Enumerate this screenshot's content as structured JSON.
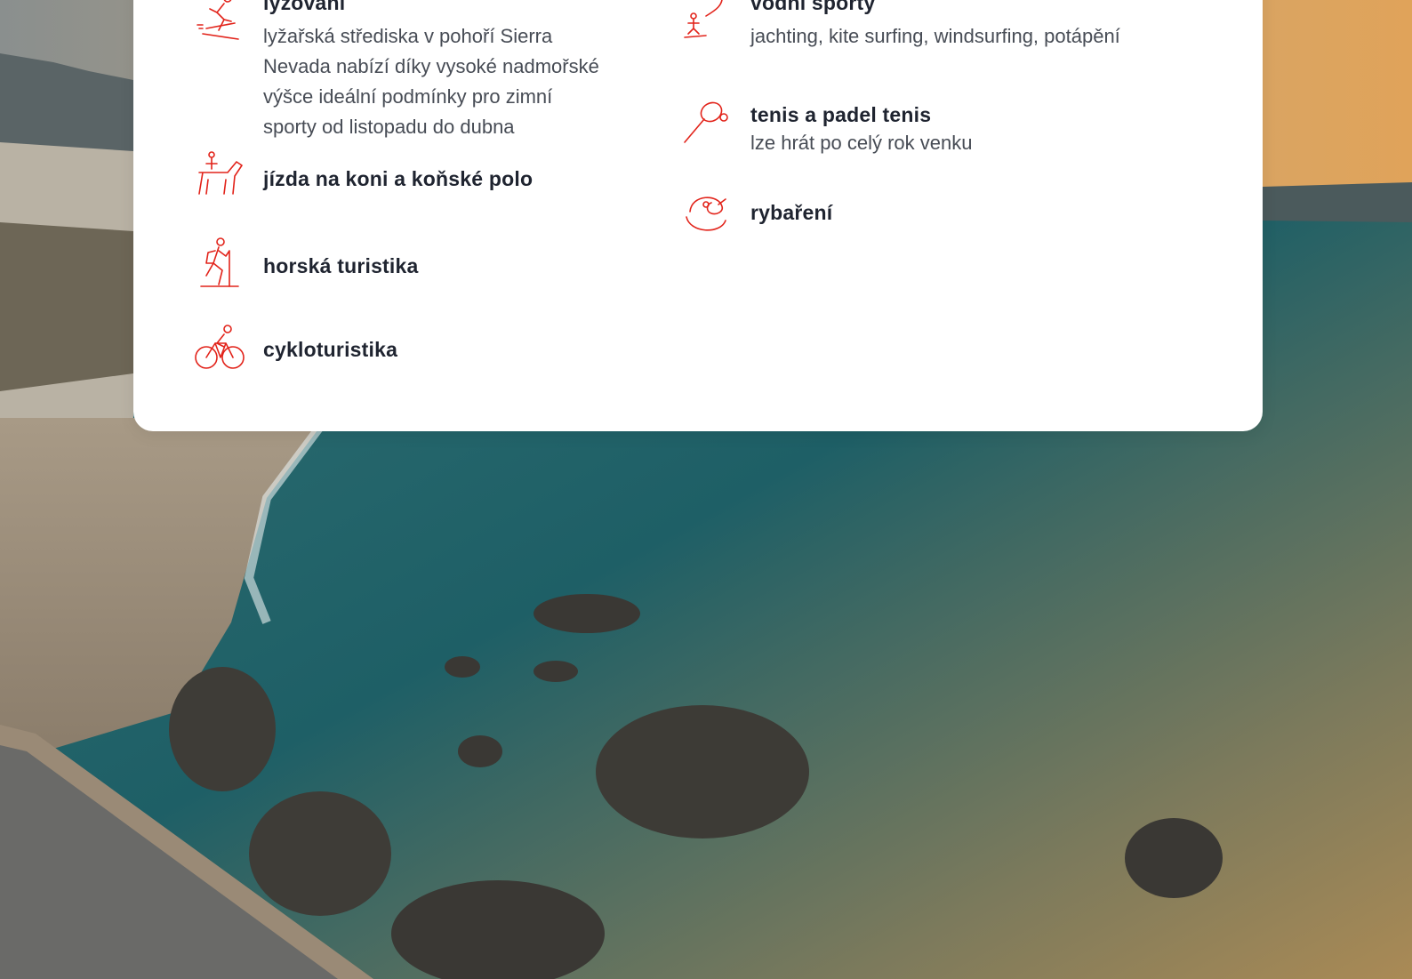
{
  "left_items": [
    {
      "title": "lyžování",
      "desc": "lyžařská střediska v pohoří Sierra Nevada nabízí díky vysoké nadmořské výšce ideální podmínky pro zimní sporty od listopadu do dubna",
      "icon": "skiing-icon"
    },
    {
      "title": "jízda na koni a koňské polo",
      "icon": "horse-riding-icon"
    },
    {
      "title": "horská turistika",
      "icon": "hiking-icon"
    },
    {
      "title": "cykloturistika",
      "icon": "cycling-icon"
    }
  ],
  "right_items": [
    {
      "title": "vodní sporty",
      "desc": "jachting, kite surfing, windsurfing, potápění",
      "icon": "kite-surfing-icon"
    },
    {
      "title": "tenis a padel tenis",
      "desc": "lze hrát po celý rok venku",
      "icon": "tennis-icon"
    },
    {
      "title": "rybaření",
      "icon": "fishing-icon"
    }
  ],
  "colors": {
    "accent": "#e2231a",
    "title": "#1f2430",
    "desc": "#474c55",
    "card": "#ffffff"
  }
}
